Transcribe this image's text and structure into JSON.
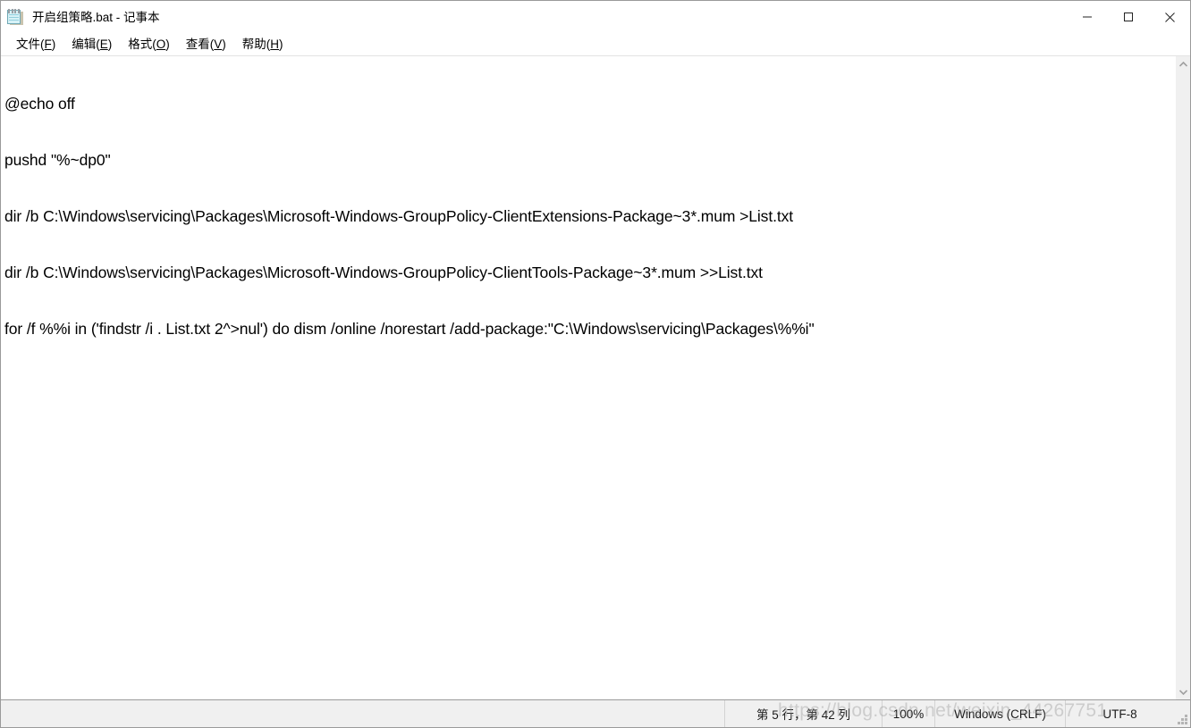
{
  "window": {
    "title": "开启组策略.bat - 记事本",
    "app_icon": "notepad-icon",
    "controls": {
      "minimize": "最小化",
      "maximize": "最大化",
      "close": "关闭"
    }
  },
  "menubar": {
    "items": [
      {
        "label": "文件(F)",
        "name": "file",
        "pre": "文件(",
        "accel": "F",
        "post": ")"
      },
      {
        "label": "编辑(E)",
        "name": "edit",
        "pre": "编辑(",
        "accel": "E",
        "post": ")"
      },
      {
        "label": "格式(O)",
        "name": "format",
        "pre": "格式(",
        "accel": "O",
        "post": ")"
      },
      {
        "label": "查看(V)",
        "name": "view",
        "pre": "查看(",
        "accel": "V",
        "post": ")"
      },
      {
        "label": "帮助(H)",
        "name": "help",
        "pre": "帮助(",
        "accel": "H",
        "post": ")"
      }
    ]
  },
  "editor": {
    "lines": [
      "@echo off",
      "pushd \"%~dp0\"",
      "dir /b C:\\Windows\\servicing\\Packages\\Microsoft-Windows-GroupPolicy-ClientExtensions-Package~3*.mum >List.txt",
      "dir /b C:\\Windows\\servicing\\Packages\\Microsoft-Windows-GroupPolicy-ClientTools-Package~3*.mum >>List.txt",
      "for /f %%i in ('findstr /i . List.txt 2^>nul') do dism /online /norestart /add-package:\"C:\\Windows\\servicing\\Packages\\%%i\""
    ]
  },
  "scrollbar": {
    "up_arrow": "scroll-up-icon",
    "down_arrow": "scroll-down-icon"
  },
  "statusbar": {
    "position": "第 5 行，第 42 列",
    "zoom": "100%",
    "line_ending": "Windows (CRLF)",
    "encoding": "UTF-8"
  },
  "watermark": {
    "text": "https://blog.csdn.net/weixin_44267751"
  },
  "colors": {
    "window_border": "#9a9a9a",
    "statusbar_bg": "#f0f0f0",
    "scrollbar_bg": "#f0f0f0",
    "text": "#000000",
    "icon_blue": "#d7f2f7"
  }
}
